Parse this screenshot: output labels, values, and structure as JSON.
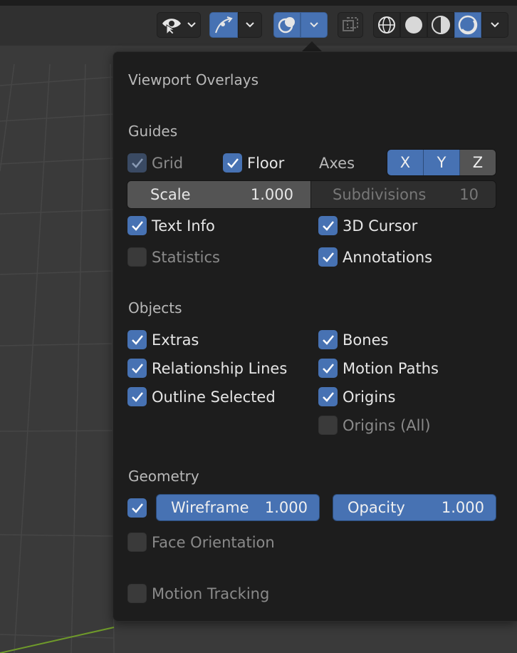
{
  "colors": {
    "accent": "#4772b3",
    "panel_bg": "#1d1d1d",
    "checkbox_off": "#545454",
    "viewport_bg": "#3a3a3a",
    "grid_line": "#464646",
    "x_axis_line": "#6f9a2a"
  },
  "header": {
    "icons": [
      "eye-cursor-icon",
      "chevron-down-icon",
      "gizmo-icon",
      "chevron-down-icon",
      "overlays-icon",
      "chevron-down-icon",
      "xray-icon",
      "wireframe-shading-icon",
      "solid-shading-icon",
      "material-shading-icon",
      "rendered-shading-icon",
      "chevron-down-icon"
    ]
  },
  "popover": {
    "title": "Viewport Overlays",
    "guides": {
      "heading": "Guides",
      "grid_label": "Grid",
      "grid_checked": true,
      "floor_label": "Floor",
      "floor_checked": true,
      "axes_label": "Axes",
      "axes": [
        "X",
        "Y",
        "Z"
      ],
      "scale_label": "Scale",
      "scale_value": "1.000",
      "subdivisions_label": "Subdivisions",
      "subdivisions_value": "10",
      "text_info_label": "Text Info",
      "text_info_checked": true,
      "cursor_label": "3D Cursor",
      "cursor_checked": true,
      "statistics_label": "Statistics",
      "statistics_checked": false,
      "annotations_label": "Annotations",
      "annotations_checked": true
    },
    "objects": {
      "heading": "Objects",
      "extras_label": "Extras",
      "bones_label": "Bones",
      "relationship_label": "Relationship Lines",
      "motion_paths_label": "Motion Paths",
      "outline_label": "Outline Selected",
      "origins_label": "Origins",
      "origins_all_label": "Origins (All)"
    },
    "geometry": {
      "heading": "Geometry",
      "wireframe_checked": true,
      "wireframe_label": "Wireframe",
      "wireframe_value": "1.000",
      "opacity_label": "Opacity",
      "opacity_value": "1.000",
      "face_orientation_label": "Face Orientation"
    },
    "motion_tracking_label": "Motion Tracking"
  }
}
